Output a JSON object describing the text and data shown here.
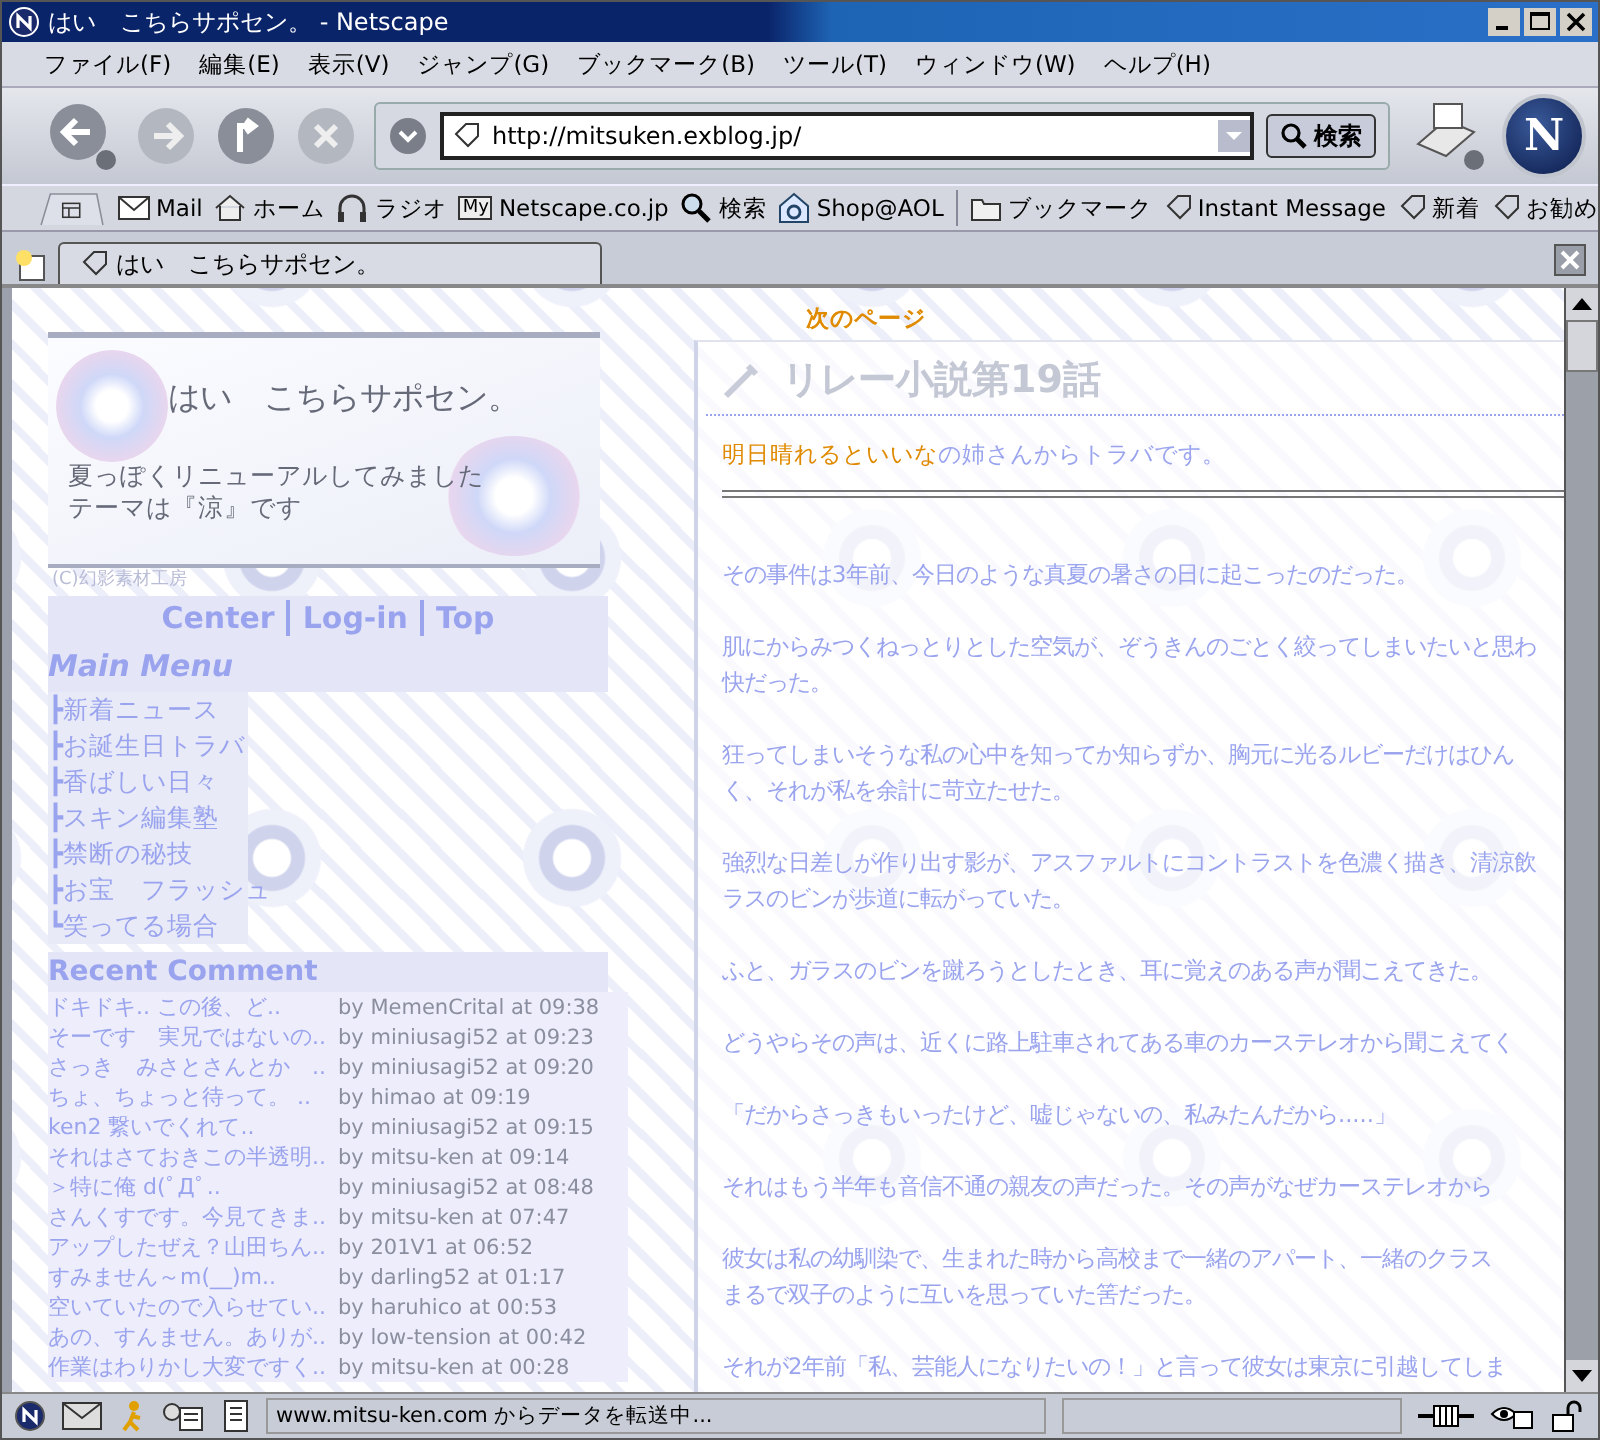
{
  "window": {
    "title": "はい　こちらサポセン。 - Netscape"
  },
  "menu": [
    "ファイル(F)",
    "編集(E)",
    "表示(V)",
    "ジャンプ(G)",
    "ブックマーク(B)",
    "ツール(T)",
    "ウィンドウ(W)",
    "ヘルプ(H)"
  ],
  "navigation": {
    "address": "http://mitsuken.exblog.jp/",
    "search_button": "検索",
    "brand_mark": "N"
  },
  "personal_toolbar": [
    {
      "kind": "mail",
      "label": "Mail"
    },
    {
      "kind": "home",
      "label": "ホーム"
    },
    {
      "kind": "radio",
      "label": "ラジオ"
    },
    {
      "kind": "my",
      "label": "Netscape.co.jp",
      "badge": "My"
    },
    {
      "kind": "search",
      "label": "検索"
    },
    {
      "kind": "shop",
      "label": "Shop@AOL"
    },
    {
      "kind": "folder",
      "label": "ブックマーク"
    },
    {
      "kind": "link",
      "label": "Instant Message"
    },
    {
      "kind": "link",
      "label": "新着"
    },
    {
      "kind": "link",
      "label": "お勧め"
    }
  ],
  "tabs": [
    {
      "label": "はい　こちらサポセン。",
      "selected": true
    }
  ],
  "page": {
    "header": {
      "title": "はい　こちらサポセン。",
      "subtitle": [
        "夏っぽくリニューアルしてみました",
        "テーマは『涼』です"
      ],
      "credit": "(C)幻影素材工房"
    },
    "nav_links": [
      "Center",
      "Log-in",
      "Top"
    ],
    "main_menu": {
      "title": "Main Menu",
      "items": [
        "┣新着ニュース",
        "┣お誕生日トラバ",
        "┣香ばしい日々",
        "┣スキン編集塾",
        "┣禁断の秘技",
        "┣お宝　フラッシュ",
        "┗笑ってる場合"
      ]
    },
    "recent_comment": {
      "title": "Recent Comment",
      "rows": [
        {
          "text": "ドキドキ.. この後、ど..",
          "by": "by MemenCrital at 09:38"
        },
        {
          "text": "そーです　実兄ではないの..",
          "by": "by miniusagi52 at 09:23"
        },
        {
          "text": "さっき　みさとさんとか　..",
          "by": "by miniusagi52 at 09:20"
        },
        {
          "text": "ちょ、ちょっと待って。 ..",
          "by": "by himao at 09:19"
        },
        {
          "text": "ken2 繋いでくれて..",
          "by": "by miniusagi52 at 09:15"
        },
        {
          "text": "それはさておきこの半透明..",
          "by": "by mitsu-ken at 09:14"
        },
        {
          "text": "＞特に俺 d(ﾟДﾟ..",
          "by": "by miniusagi52 at 08:48"
        },
        {
          "text": "さんくすです。今見てきま..",
          "by": "by mitsu-ken at 07:47"
        },
        {
          "text": "アップしたぜえ？山田ちん..",
          "by": "by 201V1 at 06:52"
        },
        {
          "text": "すみません～m(__)m..",
          "by": "by darling52 at 01:17"
        },
        {
          "text": "空いていたので入らせてい..",
          "by": "by haruhico at 00:53"
        },
        {
          "text": "あの、すんません。ありが..",
          "by": "by low-tension at 00:42"
        },
        {
          "text": "作業はわりかし大変ですく..",
          "by": "by mitsu-ken at 00:28"
        }
      ]
    },
    "next_page": "次のページ",
    "article": {
      "title": "リレー小説第19話",
      "intro_link": "明日晴れるといいな",
      "intro_rest": "の姉さんからトラバです。",
      "paragraphs": [
        [
          "その事件は3年前、今日のような真夏の暑さの日に起こったのだった。"
        ],
        [
          "肌にからみつくねっとりとした空気が、ぞうきんのごとく絞ってしまいたいと思わ",
          "快だった。"
        ],
        [
          "狂ってしまいそうな私の心中を知ってか知らずか、胸元に光るルビーだけはひん",
          "く、それが私を余計に苛立たせた。"
        ],
        [
          "強烈な日差しが作り出す影が、アスファルトにコントラストを色濃く描き、清涼飲",
          "ラスのビンが歩道に転がっていた。"
        ],
        [
          "ふと、ガラスのビンを蹴ろうとしたとき、耳に覚えのある声が聞こえてきた。"
        ],
        [
          "どうやらその声は、近くに路上駐車されてある車のカーステレオから聞こえてく"
        ],
        [
          "「だからさっきもいったけど、嘘じゃないの、私みたんだから.....」"
        ],
        [
          "それはもう半年も音信不通の親友の声だった。その声がなぜカーステレオから"
        ],
        [
          "彼女は私の幼馴染で、生まれた時から高校まで一緒のアパート、一緒のクラス",
          "まるで双子のように互いを思っていた筈だった。"
        ],
        [
          "それが2年前「私、芸能人になりたいの！」と言って彼女は東京に引越してしま"
        ]
      ]
    }
  },
  "status_bar": {
    "text": "www.mitsu-ken.com からデータを転送中..."
  }
}
